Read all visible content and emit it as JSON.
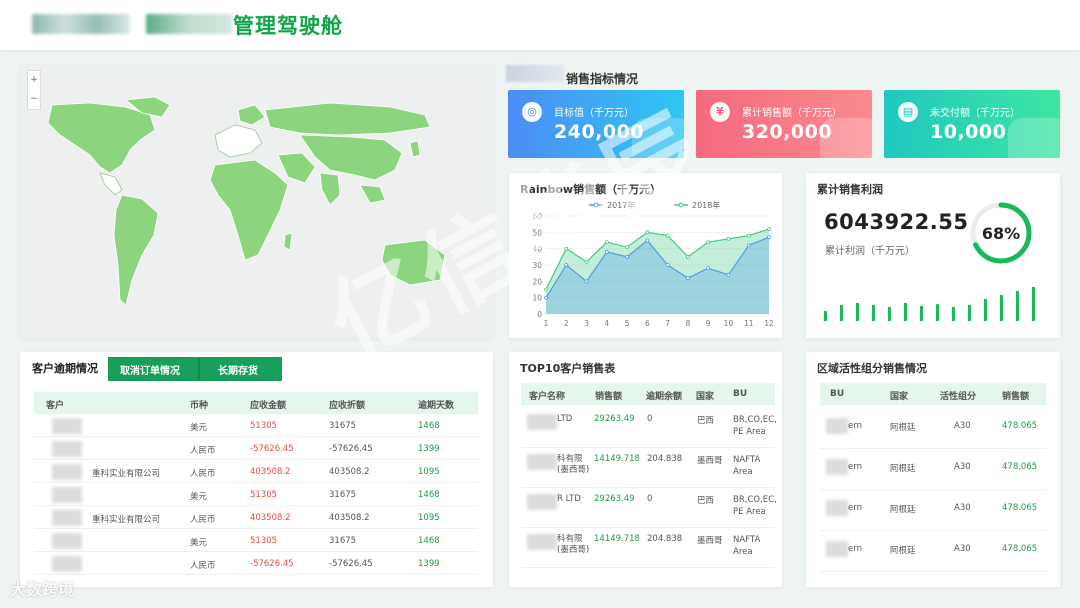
{
  "header": {
    "title": "管理驾驶舱"
  },
  "kpi_section_title": "销售指标情况",
  "kpis": [
    {
      "label": "目标值（千万元）",
      "value": "240,000",
      "color_from": "#4d8cf5",
      "color_to": "#2ec7f0",
      "icon": "target-icon"
    },
    {
      "label": "累计销售额（千万元）",
      "value": "320,000",
      "color_from": "#f56a7e",
      "color_to": "#fa8a8f",
      "icon": "yen-icon"
    },
    {
      "label": "未交付额（千万元）",
      "value": "10,000",
      "color_from": "#20c7c0",
      "color_to": "#3ee6a1",
      "icon": "document-icon"
    }
  ],
  "rainbow": {
    "title": "Rainbow销售额（千万元）",
    "legend": [
      "2017年",
      "2018年"
    ]
  },
  "chart_data": {
    "type": "area",
    "title": "Rainbow销售额（千万元）",
    "categories": [
      "1",
      "2",
      "3",
      "4",
      "5",
      "6",
      "7",
      "8",
      "9",
      "10",
      "11",
      "12"
    ],
    "ylim": [
      0,
      60
    ],
    "yticks": [
      "0",
      "10",
      "20",
      "30",
      "40",
      "50",
      "60"
    ],
    "series": [
      {
        "name": "2017年",
        "values": [
          10,
          30,
          20,
          38,
          35,
          45,
          30,
          22,
          28,
          24,
          42,
          47
        ]
      },
      {
        "name": "2018年",
        "values": [
          15,
          40,
          32,
          44,
          41,
          50,
          48,
          35,
          44,
          46,
          48,
          52
        ]
      }
    ],
    "legend": "top"
  },
  "profit": {
    "title": "累计销售利润",
    "value": "6043922.55",
    "label": "累计利润（千万元）",
    "percent_text": "68%",
    "percent": 0.68,
    "bars": [
      0.25,
      0.4,
      0.45,
      0.4,
      0.35,
      0.45,
      0.38,
      0.42,
      0.35,
      0.4,
      0.55,
      0.65,
      0.75,
      0.85
    ]
  },
  "customer": {
    "tabs": [
      "客户逾期情况",
      "取消订单情况",
      "长期存货"
    ],
    "headers": [
      "客户",
      "币种",
      "应收金额",
      "应收折额",
      "逾期天数"
    ],
    "rows": [
      {
        "customer": "",
        "currency": "美元",
        "receivable": "51305",
        "converted": "31675",
        "days": "1468"
      },
      {
        "customer": "",
        "currency": "人民币",
        "receivable": "-57626.45",
        "converted": "-57626.45",
        "days": "1399"
      },
      {
        "customer": "重科实业有限公司",
        "currency": "人民币",
        "receivable": "403508.2",
        "converted": "403508.2",
        "days": "1095"
      },
      {
        "customer": "",
        "currency": "美元",
        "receivable": "51305",
        "converted": "31675",
        "days": "1468"
      },
      {
        "customer": "重科实业有限公司",
        "currency": "人民币",
        "receivable": "403508.2",
        "converted": "403508.2",
        "days": "1095"
      },
      {
        "customer": "",
        "currency": "美元",
        "receivable": "51305",
        "converted": "31675",
        "days": "1468"
      },
      {
        "customer": "",
        "currency": "人民币",
        "receivable": "-57626.45",
        "converted": "-57626.45",
        "days": "1399"
      }
    ]
  },
  "top10": {
    "title": "TOP10客户销售表",
    "headers": [
      "客户名称",
      "销售额",
      "逾期余额",
      "国家",
      "BU"
    ],
    "rows": [
      {
        "customer": "LTD",
        "sales": "29263.49",
        "other": "0",
        "country": "巴西",
        "bu": "BR,CO,EC, PE Area"
      },
      {
        "customer": "科有限 (墨西哥)",
        "sales": "14149.718",
        "other": "204.838",
        "country": "墨西哥",
        "bu": "NAFTA Area"
      },
      {
        "customer": "R LTD",
        "sales": "29263.49",
        "other": "0",
        "country": "巴西",
        "bu": "BR,CO,EC, PE Area"
      },
      {
        "customer": "科有限 (墨西哥)",
        "sales": "14149.718",
        "other": "204.838",
        "country": "墨西哥",
        "bu": "NAFTA Area"
      }
    ]
  },
  "bu": {
    "title": "区域活性组分销售情况",
    "headers": [
      "BU",
      "国家",
      "活性组分",
      "销售额"
    ],
    "rows": [
      {
        "bu": "ern",
        "country": "阿根廷",
        "component": "A30",
        "sales": "478.065"
      },
      {
        "bu": "ern",
        "country": "阿根廷",
        "component": "A30",
        "sales": "478.065"
      },
      {
        "bu": "ern",
        "country": "阿根廷",
        "component": "A30",
        "sales": "478.065"
      },
      {
        "bu": "ern",
        "country": "阿根廷",
        "component": "A30",
        "sales": "478.065"
      }
    ]
  },
  "watermark": "亿信华辰",
  "brand": "大数跨境"
}
